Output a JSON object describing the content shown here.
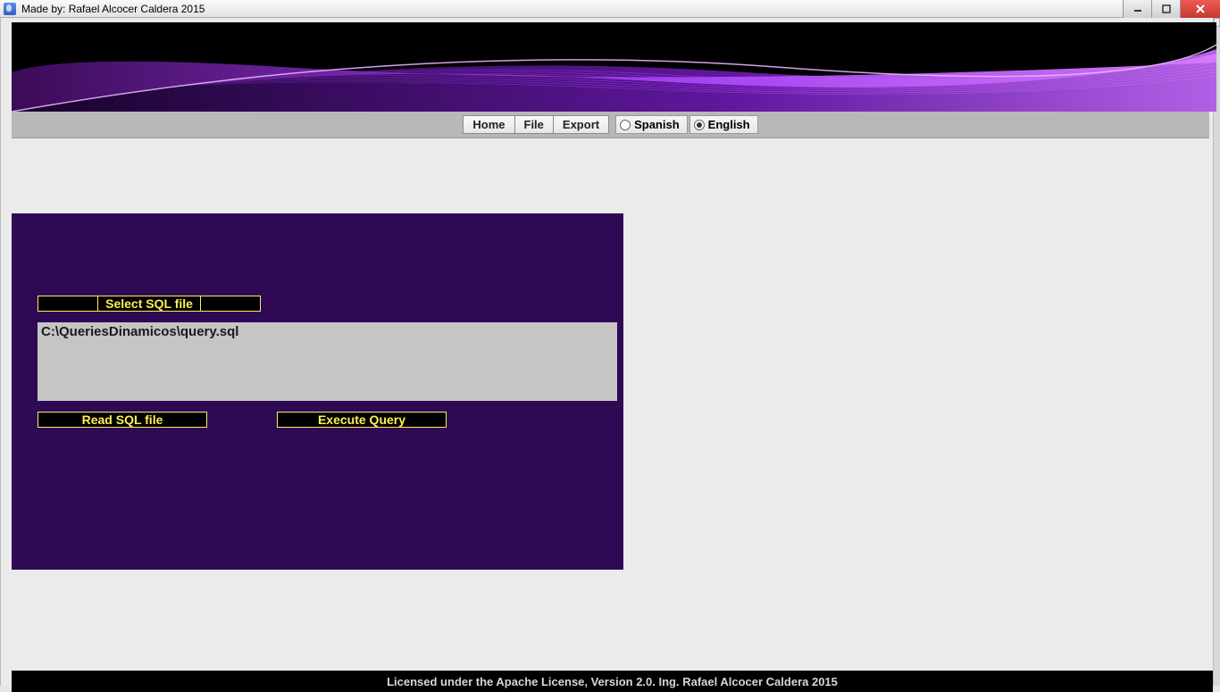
{
  "window": {
    "title": "Made by: Rafael Alcocer Caldera 2015"
  },
  "menu": {
    "home": "Home",
    "file": "File",
    "export": "Export"
  },
  "language": {
    "spanish": "Spanish",
    "english": "English",
    "selected": "english"
  },
  "panel": {
    "select_label": "Select SQL file",
    "file_path": "C:\\QueriesDinamicos\\query.sql",
    "read_label": "Read SQL file",
    "execute_label": "Execute Query"
  },
  "footer": {
    "text": "Licensed under the Apache License, Version 2.0. Ing. Rafael Alcocer Caldera 2015"
  }
}
